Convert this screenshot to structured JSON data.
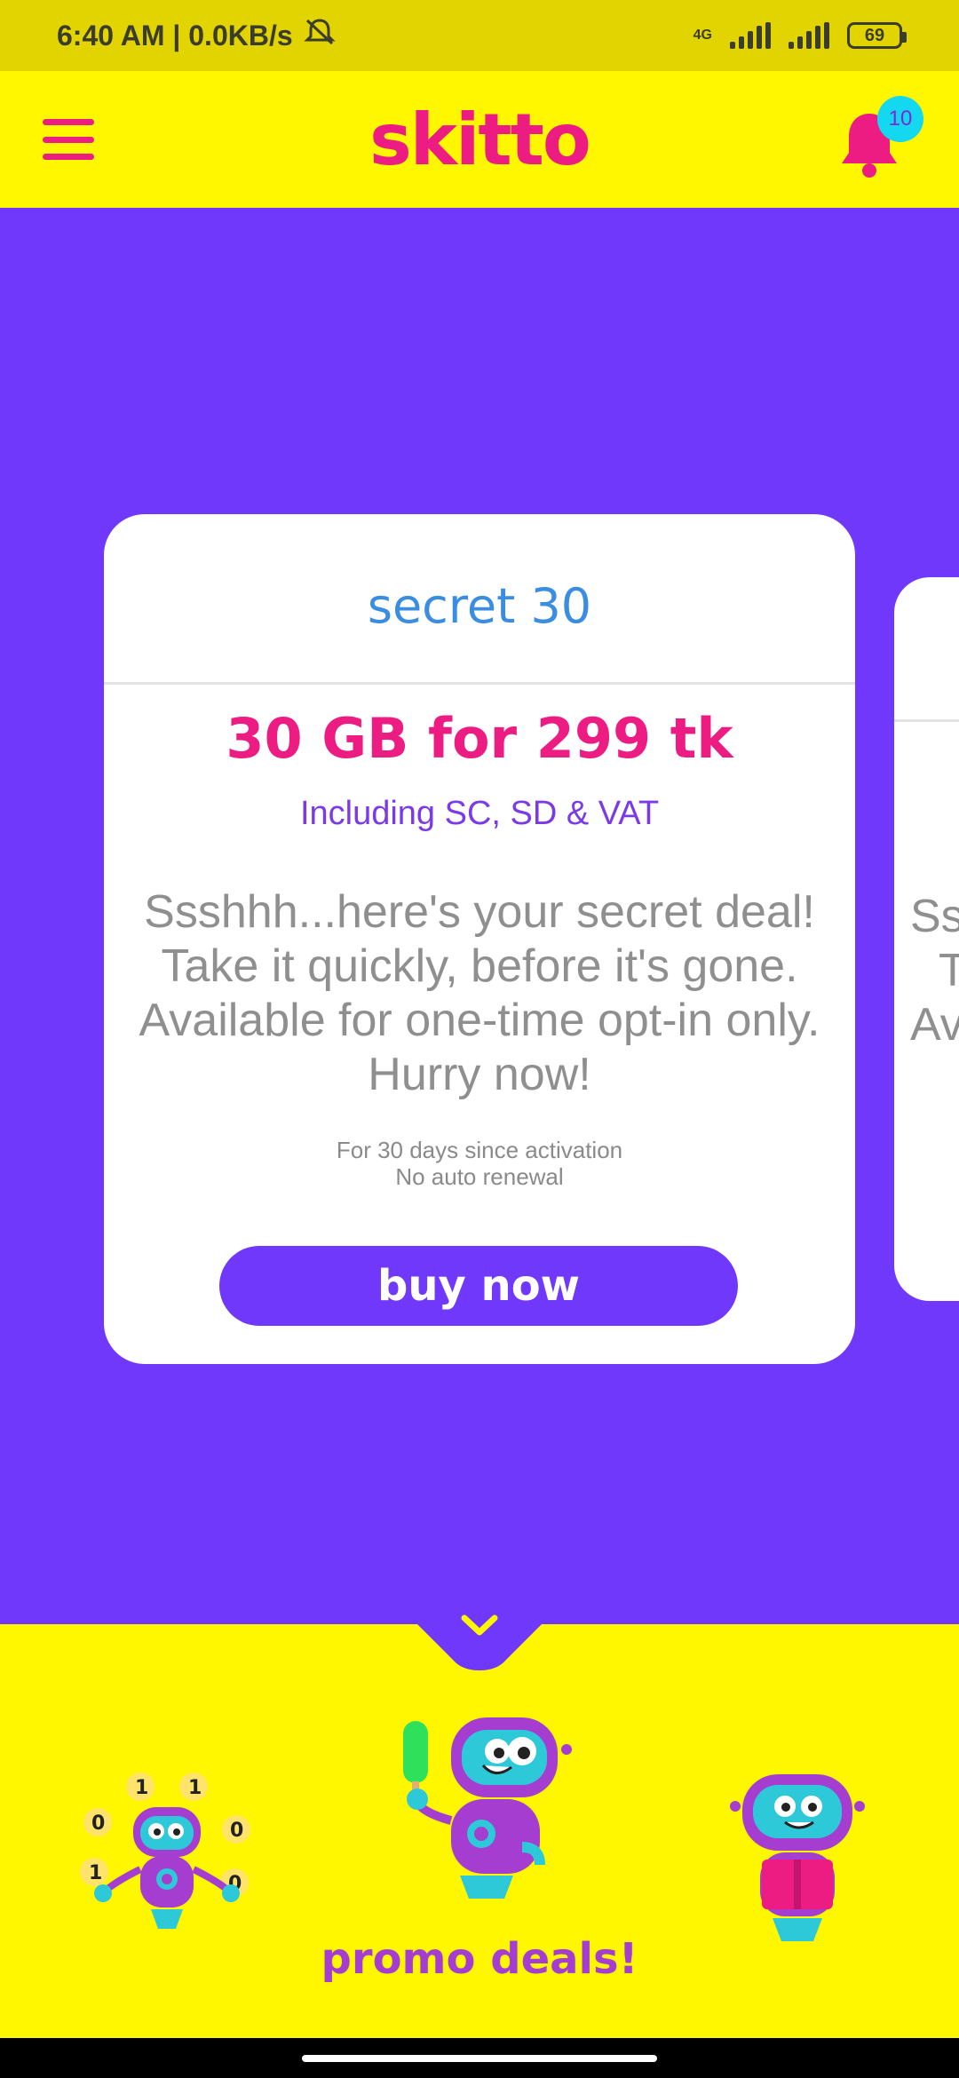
{
  "status_bar": {
    "time_text": "6:40 AM | 0.0KB/s",
    "network_type": "4G",
    "battery_level": "69",
    "icons": [
      "mute-notifications-icon",
      "signal-icon",
      "signal-icon",
      "battery-icon"
    ]
  },
  "app_bar": {
    "logo_text": "skitto",
    "notification_count": "10",
    "icons": [
      "hamburger-menu-icon",
      "bell-icon"
    ]
  },
  "offer_card": {
    "title": "secret 30",
    "price": "30 GB for 299 tk",
    "tax_note": "Including SC, SD & VAT",
    "description_lines": [
      "Ssshhh...here's your secret deal!",
      "Take it quickly, before it's gone.",
      "Available for one-time opt-in only.",
      "Hurry now!"
    ],
    "terms_lines": [
      "For 30 days since activation",
      "No auto renewal"
    ],
    "button_label": "buy now"
  },
  "next_card_peek": {
    "lines": [
      "Ss",
      "T",
      "Ava"
    ]
  },
  "bottom": {
    "label": "promo deals!",
    "icons": [
      "chevron-down-icon",
      "robot-juggler-icon",
      "robot-popsicle-icon",
      "robot-gift-icon"
    ]
  },
  "colors": {
    "status_bar": "#e1d400",
    "app_bar": "#fff700",
    "background": "#6f38fa",
    "brand_pink": "#ec1c82",
    "title_blue": "#3a8de0",
    "badge_cyan": "#14d8f0",
    "promo_purple": "#a53ed0"
  }
}
